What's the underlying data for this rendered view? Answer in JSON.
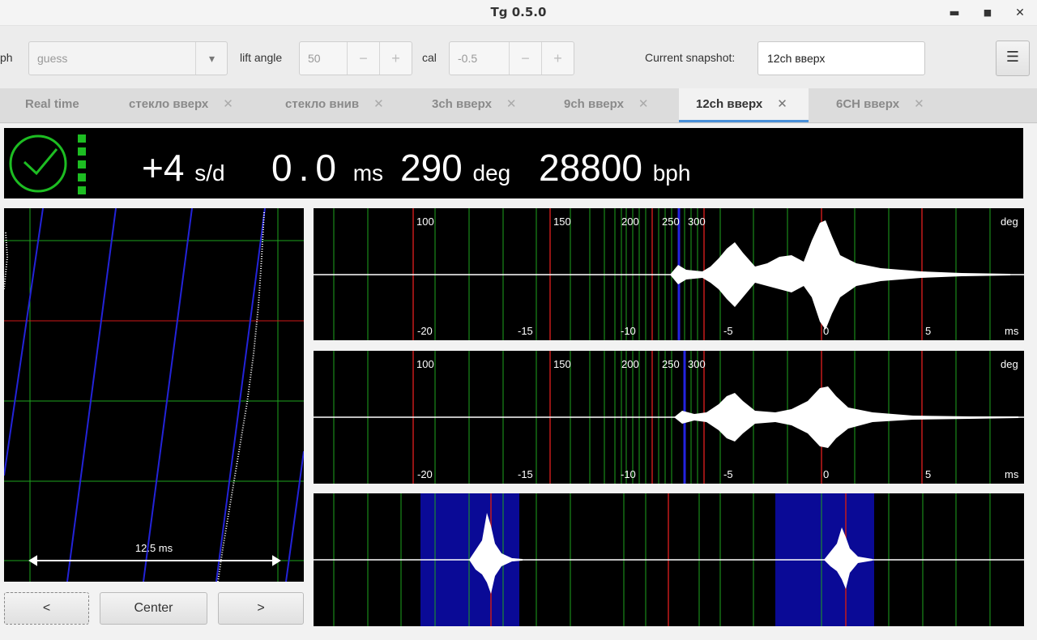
{
  "window": {
    "title": "Tg 0.5.0",
    "minimize": "▬",
    "maximize": "■",
    "close": "✕"
  },
  "toolbar": {
    "bph_label": "ph",
    "bph_value": "guess",
    "lift_angle_label": "lift angle",
    "lift_angle_value": "50",
    "cal_label": "cal",
    "cal_value": "-0.5",
    "minus": "−",
    "plus": "+",
    "dropdown_arrow": "▾",
    "snapshot_label": "Current snapshot:",
    "snapshot_value": "12ch вверх",
    "menu_glyph": "☰"
  },
  "tabs": [
    {
      "label": "Real time",
      "closable": false
    },
    {
      "label": "стекло вверх",
      "closable": true
    },
    {
      "label": "стекло внив",
      "closable": true
    },
    {
      "label": "3ch вверх",
      "closable": true
    },
    {
      "label": "9ch вверх",
      "closable": true
    },
    {
      "label": "12ch вверх",
      "closable": true,
      "active": true
    },
    {
      "label": "6CH вверх",
      "closable": true
    }
  ],
  "tab_close_glyph": "✕",
  "status": {
    "rate_value": "+4",
    "rate_unit": "s/d",
    "beat_error_value": "0.0",
    "beat_error_unit": "ms",
    "amplitude_value": "290",
    "amplitude_unit": "deg",
    "bph_value": "28800",
    "bph_unit": "bph",
    "status_color": "#1dbd22"
  },
  "paperstrip": {
    "scale_label": "12.5 ms"
  },
  "waveform": {
    "deg_labels": [
      "100",
      "150",
      "200",
      "250",
      "300"
    ],
    "deg_unit": "deg",
    "ms_labels": [
      "-20",
      "-15",
      "-10",
      "-5",
      "0",
      "5"
    ],
    "ms_unit": "ms"
  },
  "nav": {
    "prev": "<",
    "center": "Center",
    "next": ">"
  }
}
